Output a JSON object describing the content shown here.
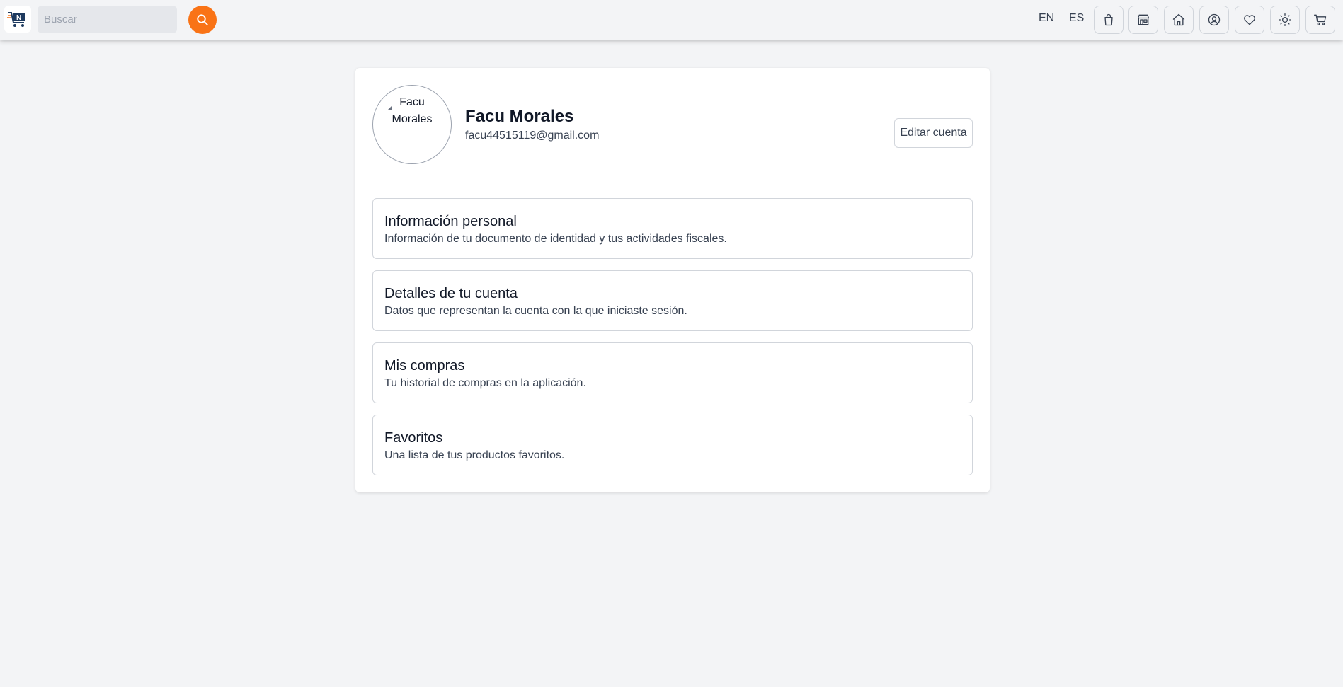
{
  "header": {
    "search_placeholder": "Buscar",
    "lang_en": "EN",
    "lang_es": "ES",
    "accent_color": "#f97316",
    "icons": [
      "shopping-bag-icon",
      "store-icon",
      "home-icon",
      "user-circle-icon",
      "heart-icon",
      "sun-icon",
      "cart-icon"
    ]
  },
  "profile": {
    "avatar_alt": "Facu Morales",
    "name": "Facu Morales",
    "email": "facu44515119@gmail.com",
    "edit_label": "Editar cuenta"
  },
  "sections": [
    {
      "title": "Información personal",
      "description": "Información de tu documento de identidad y tus actividades fiscales."
    },
    {
      "title": "Detalles de tu cuenta",
      "description": "Datos que representan la cuenta con la que iniciaste sesión."
    },
    {
      "title": "Mis compras",
      "description": "Tu historial de compras en la aplicación."
    },
    {
      "title": "Favoritos",
      "description": "Una lista de tus productos favoritos."
    }
  ]
}
